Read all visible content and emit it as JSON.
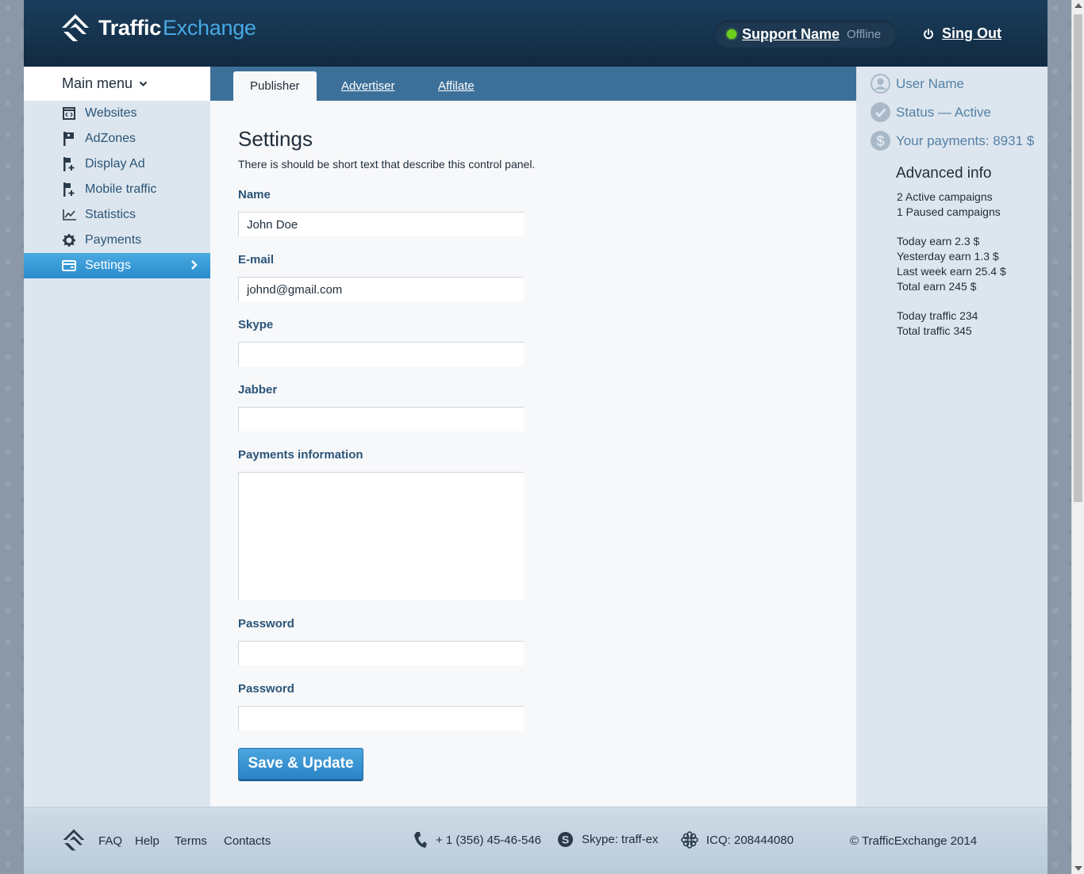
{
  "header": {
    "logo_part1": "Traffic",
    "logo_part2": "Exchange",
    "support_name": "Support Name",
    "support_status": "Offline",
    "signout_label": "Sing Out"
  },
  "sidebar": {
    "main_menu_label": "Main menu",
    "items": [
      {
        "label": "Websites",
        "icon": "browser-code-icon"
      },
      {
        "label": "AdZones",
        "icon": "flag-icon"
      },
      {
        "label": "Display Ad",
        "icon": "flag-plus-icon"
      },
      {
        "label": "Mobile traffic",
        "icon": "flag-plus-icon"
      },
      {
        "label": "Statistics",
        "icon": "chart-line-icon"
      },
      {
        "label": "Payments",
        "icon": "gear-icon"
      },
      {
        "label": "Settings",
        "icon": "card-icon",
        "active": true
      }
    ]
  },
  "tabs": [
    {
      "label": "Publisher",
      "active": true
    },
    {
      "label": "Advertiser"
    },
    {
      "label": "Affilate"
    }
  ],
  "settings": {
    "title": "Settings",
    "description": "There is should be short text that describe this control panel.",
    "fields": {
      "name": {
        "label": "Name",
        "value": "John Doe"
      },
      "email": {
        "label": "E-mail",
        "value": "johnd@gmail.com"
      },
      "skype": {
        "label": "Skype",
        "value": ""
      },
      "jabber": {
        "label": "Jabber",
        "value": ""
      },
      "payments": {
        "label": "Payments information",
        "value": ""
      },
      "password": {
        "label": "Password",
        "value": ""
      },
      "password2": {
        "label": "Password",
        "value": ""
      }
    },
    "save_label": "Save & Update"
  },
  "right_panel": {
    "user_name": "User Name",
    "status": "Status — Active",
    "payments": "Your payments: 8931 $",
    "advanced_title": "Advanced info",
    "lines": [
      "2 Active campaigns",
      "1 Paused campaigns",
      "Today earn 2.3 $",
      "Yesterday earn 1.3 $",
      "Last week earn 25.4 $",
      "Total earn 245 $",
      "Today traffic 234",
      "Total traffic 345"
    ]
  },
  "footer": {
    "links": [
      "FAQ",
      "Help",
      "Terms",
      "Contacts"
    ],
    "phone": "+ 1 (356) 45-46-546",
    "skype": "Skype: traff-ex",
    "icq": "ICQ: 208444080",
    "copyright": "© TrafficExchange 2014"
  },
  "colors": {
    "header_bg": "#15334d",
    "accent": "#2a8ccd",
    "link_blue": "#2a5478",
    "online_dot": "#6bd01c"
  }
}
